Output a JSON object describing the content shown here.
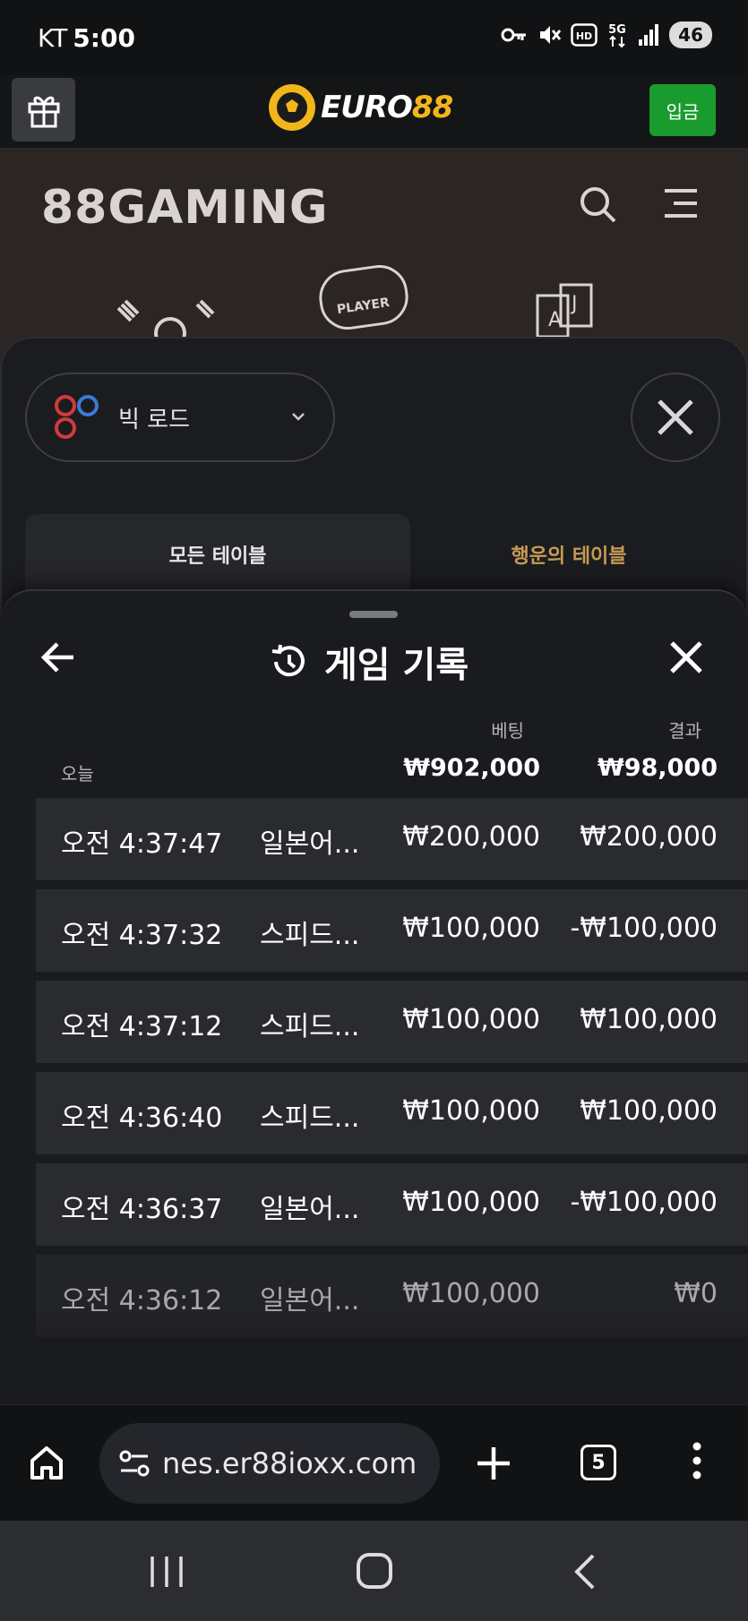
{
  "status_bar": {
    "carrier": "KT",
    "time": "5:00",
    "battery": "46"
  },
  "header": {
    "brand_main": "EURO",
    "brand_accent": "88",
    "deposit_label": "입금"
  },
  "background_page": {
    "gaming_logo": "88GAMING",
    "player_badge_label": "PLAYER"
  },
  "road_panel": {
    "road_select_label": "빅 로드",
    "tabs": [
      {
        "label": "모든 테이블"
      },
      {
        "label": "행운의 테이블"
      }
    ]
  },
  "history": {
    "title": "게임 기록",
    "bet_header": "베팅",
    "result_header": "결과",
    "today_label": "오늘",
    "total_bet": "₩902,000",
    "total_result": "₩98,000",
    "rows": [
      {
        "time": "오전 4:37:47",
        "game": "일본어...",
        "bet": "₩200,000",
        "result": "₩200,000"
      },
      {
        "time": "오전 4:37:32",
        "game": "스피드...",
        "bet": "₩100,000",
        "result": "-₩100,000"
      },
      {
        "time": "오전 4:37:12",
        "game": "스피드...",
        "bet": "₩100,000",
        "result": "₩100,000"
      },
      {
        "time": "오전 4:36:40",
        "game": "스피드...",
        "bet": "₩100,000",
        "result": "₩100,000"
      },
      {
        "time": "오전 4:36:37",
        "game": "일본어...",
        "bet": "₩100,000",
        "result": "-₩100,000"
      },
      {
        "time": "오전 4:36:12",
        "game": "일본어...",
        "bet": "₩100,000",
        "result": "₩0"
      }
    ]
  },
  "browser": {
    "url": "nes.er88ioxx.com",
    "tab_count": "5"
  },
  "colors": {
    "deposit_green": "#1a9b2e",
    "brand_gold": "#f2b51c",
    "lucky_tab": "#c79a55"
  }
}
